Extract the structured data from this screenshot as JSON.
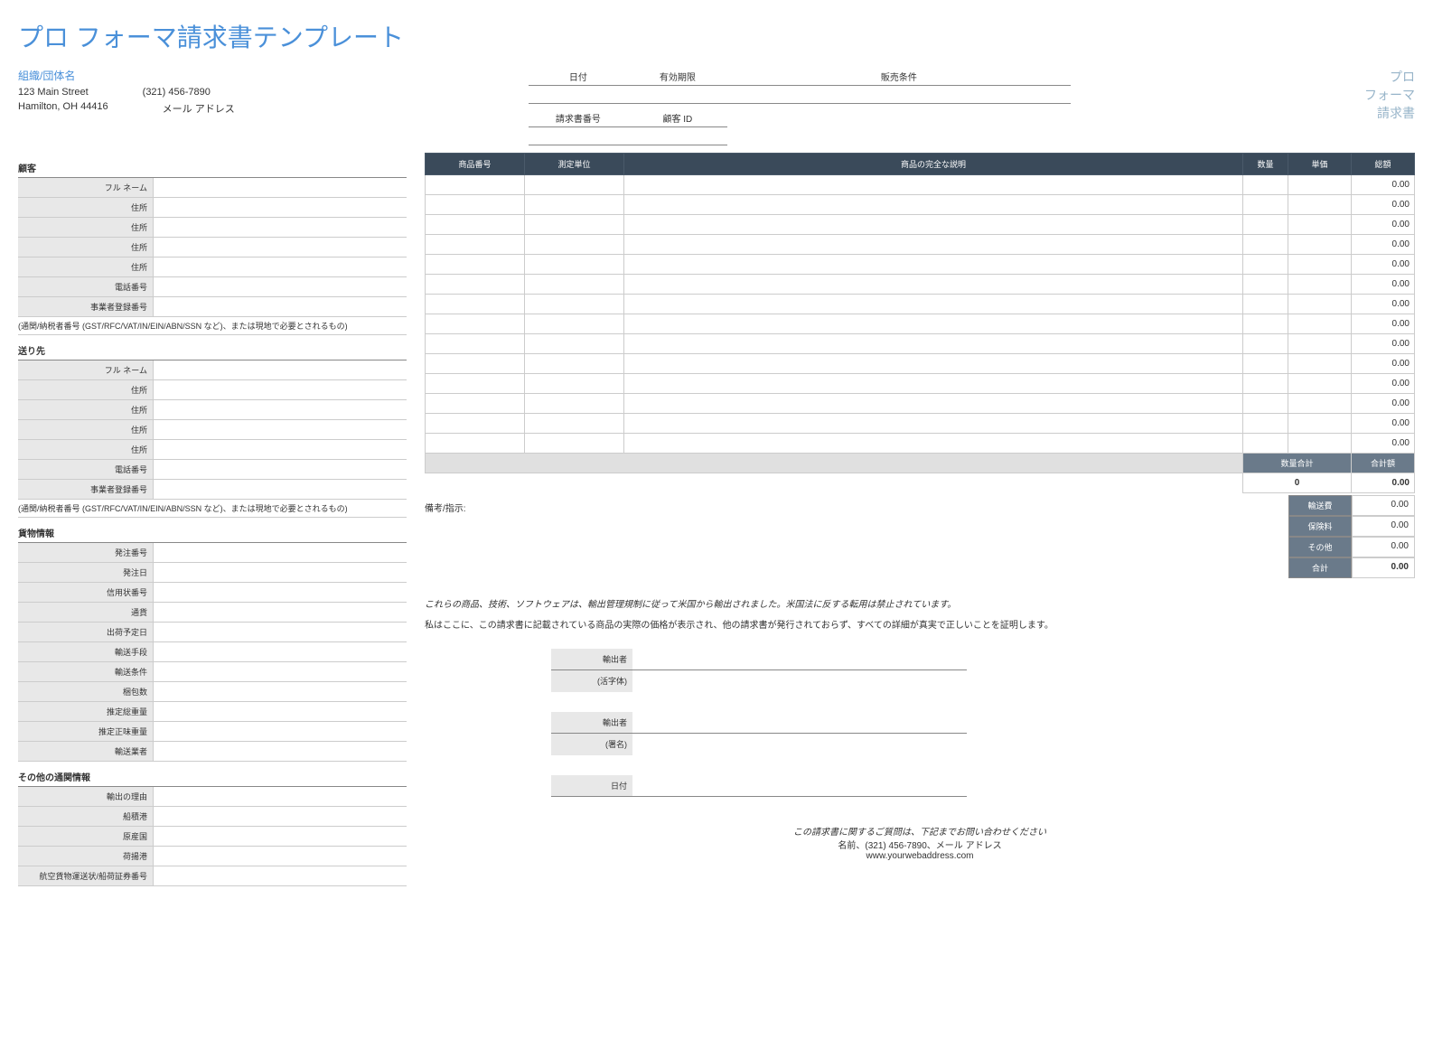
{
  "title": "プロ フォーマ請求書テンプレート",
  "org": {
    "name": "組織/団体名",
    "street": "123 Main Street",
    "phone": "(321) 456-7890",
    "citystate": "Hamilton, OH 44416",
    "email": "メール アドレス"
  },
  "dateHeaders": {
    "date": "日付",
    "expiry": "有効期限",
    "terms": "販売条件",
    "invNo": "請求書番号",
    "custId": "顧客 ID"
  },
  "proforma": {
    "l1": "プロ",
    "l2": "フォーマ",
    "l3": "請求書"
  },
  "sections": {
    "customer": "顧客",
    "shipto": "送り先",
    "freight": "貨物情報",
    "other": "その他の通関情報"
  },
  "customerFields": [
    "フル ネーム",
    "住所",
    "住所",
    "住所",
    "住所",
    "電話番号",
    "事業者登録番号"
  ],
  "taxNote": "(通関/納税者番号 (GST/RFC/VAT/IN/EIN/ABN/SSN など)、または現地で必要とされるもの)",
  "shipFields": [
    "フル ネーム",
    "住所",
    "住所",
    "住所",
    "住所",
    "電話番号",
    "事業者登録番号"
  ],
  "freightFields": [
    "発注番号",
    "発注日",
    "信用状番号",
    "通貨",
    "出荷予定日",
    "輸送手段",
    "輸送条件",
    "梱包数",
    "推定総重量",
    "推定正味重量",
    "輸送業者"
  ],
  "otherFields": [
    "輸出の理由",
    "船積港",
    "原産国",
    "荷揚港",
    "航空貨物運送状/船荷証券番号"
  ],
  "itemHeaders": {
    "itemNo": "商品番号",
    "unit": "測定単位",
    "desc": "商品の完全な説明",
    "qty": "数量",
    "price": "単価",
    "total": "総額"
  },
  "itemRows": [
    {
      "total": "0.00"
    },
    {
      "total": "0.00"
    },
    {
      "total": "0.00"
    },
    {
      "total": "0.00"
    },
    {
      "total": "0.00"
    },
    {
      "total": "0.00"
    },
    {
      "total": "0.00"
    },
    {
      "total": "0.00"
    },
    {
      "total": "0.00"
    },
    {
      "total": "0.00"
    },
    {
      "total": "0.00"
    },
    {
      "total": "0.00"
    },
    {
      "total": "0.00"
    },
    {
      "total": "0.00"
    }
  ],
  "totals": {
    "qtyLabel": "数量合計",
    "totalLabel": "合計額",
    "qty": "0",
    "total": "0.00"
  },
  "remarks": "備考/指示:",
  "summary": {
    "ship": "輸送費",
    "ins": "保険料",
    "other": "その他",
    "grand": "合計",
    "shipV": "0.00",
    "insV": "0.00",
    "otherV": "0.00",
    "grandV": "0.00"
  },
  "legal1": "これらの商品、技術、ソフトウェアは、輸出管理規制に従って米国から輸出されました。米国法に反する転用は禁止されています。",
  "legal2": "私はここに、この請求書に記載されている商品の実際の価格が表示され、他の請求書が発行されておらず、すべての詳細が真実で正しいことを証明します。",
  "sig": {
    "exporter": "輸出者",
    "print": "(活字体)",
    "sign": "(署名)",
    "date": "日付"
  },
  "footer": {
    "q": "この請求書に関するご質問は、下記までお問い合わせください",
    "contact": "名前、(321) 456-7890、メール アドレス",
    "web": "www.yourwebaddress.com"
  }
}
